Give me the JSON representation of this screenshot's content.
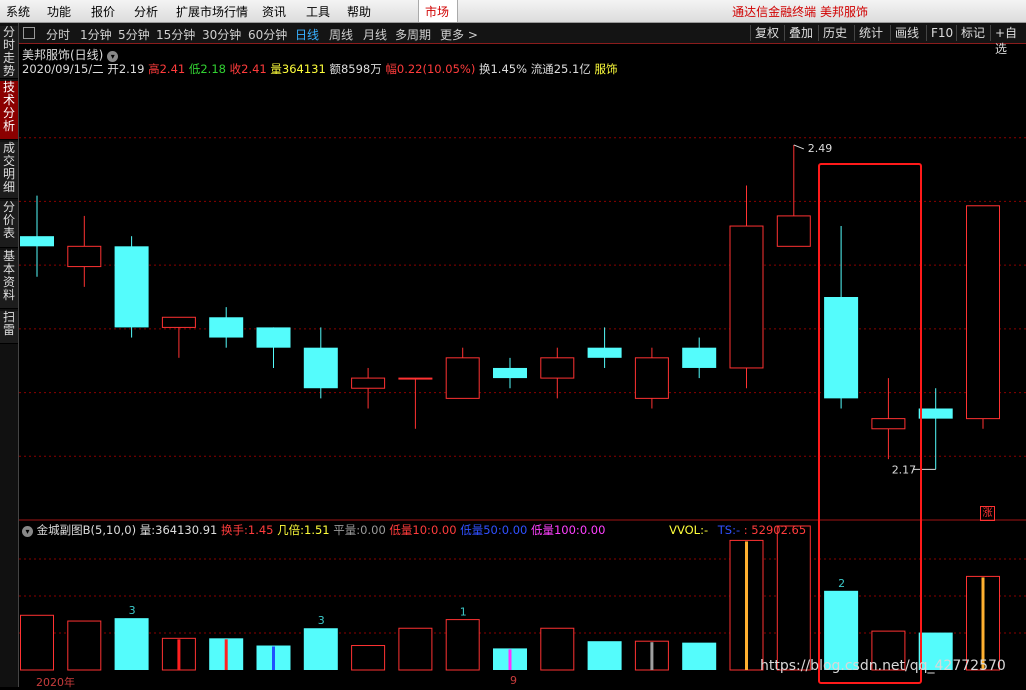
{
  "menu": {
    "items": [
      "系统",
      "功能",
      "报价",
      "分析",
      "扩展市场行情",
      "资讯",
      "工具",
      "帮助"
    ],
    "market_tab": "市场",
    "brand": "通达信金融终端  美邦服饰"
  },
  "side_tabs": [
    "分时走势",
    "技术分析",
    "成交明细",
    "分价表",
    "基本资料",
    "扫雷"
  ],
  "period_bar": {
    "items": [
      "分时",
      "1分钟",
      "5分钟",
      "15分钟",
      "30分钟",
      "60分钟",
      "日线",
      "周线",
      "月线",
      "多周期",
      "更多 >"
    ],
    "active": "日线",
    "right": [
      "复权",
      "叠加",
      "历史",
      "统计",
      "画线",
      "F10",
      "标记",
      "+自选"
    ]
  },
  "stock": {
    "title": "美邦服饰(日线)",
    "date": "2020/09/15/二",
    "open_label": "开",
    "open": "2.19",
    "high_label": "高",
    "high": "2.41",
    "low_label": "低",
    "low": "2.18",
    "close_label": "收",
    "close": "2.41",
    "vol_label": "量",
    "vol": "364131",
    "amt_label": "额",
    "amt": "8598万",
    "chg_label": "幅",
    "chg": "0.22(10.05%)",
    "turn_label": "换",
    "turn": "1.45%",
    "float_label": "流通",
    "float": "25.1亿",
    "sector": "服饰"
  },
  "indicator": {
    "name": "金城副图B(5,10,0)",
    "liang_label": "量:",
    "liang": "364130.91",
    "huanshou_label": "换手:",
    "huanshou": "1.45",
    "beibei_label": "几倍:",
    "beibei": "1.51",
    "pingliang_label": "平量:",
    "pingliang": "0.00",
    "dl10_label": "低量10:",
    "dl10": "0.00",
    "dl50_label": "低量50:",
    "dl50": "0.00",
    "dl100_label": "低量100:",
    "dl100": "0.00",
    "vvol_label": "VVOL:",
    "vvol": "-",
    "ts_label": "TS:",
    "ts": "-",
    "last": ":  52902.65"
  },
  "annotations": {
    "high_mark": "2.49",
    "low_mark": "2.17",
    "limit_badge": "涨",
    "year_label": "2020年",
    "month_label": "9",
    "watermark": "https://blog.csdn.net/qq_42772570"
  },
  "colors": {
    "up": "#ff3232",
    "down": "#54fcfc",
    "grid": "#8b0000",
    "highlight": "#ff1a1a"
  },
  "chart_data": {
    "type": "candlestick",
    "ylim": [
      2.12,
      2.56
    ],
    "candles": [
      {
        "o": 2.4,
        "h": 2.44,
        "l": 2.36,
        "c": 2.39
      },
      {
        "o": 2.37,
        "h": 2.42,
        "l": 2.35,
        "c": 2.39
      },
      {
        "o": 2.39,
        "h": 2.4,
        "l": 2.3,
        "c": 2.31
      },
      {
        "o": 2.31,
        "h": 2.32,
        "l": 2.28,
        "c": 2.32
      },
      {
        "o": 2.32,
        "h": 2.33,
        "l": 2.29,
        "c": 2.3
      },
      {
        "o": 2.31,
        "h": 2.31,
        "l": 2.27,
        "c": 2.29
      },
      {
        "o": 2.29,
        "h": 2.31,
        "l": 2.24,
        "c": 2.25
      },
      {
        "o": 2.25,
        "h": 2.27,
        "l": 2.23,
        "c": 2.26
      },
      {
        "o": 2.26,
        "h": 2.26,
        "l": 2.21,
        "c": 2.26
      },
      {
        "o": 2.24,
        "h": 2.29,
        "l": 2.24,
        "c": 2.28
      },
      {
        "o": 2.27,
        "h": 2.28,
        "l": 2.25,
        "c": 2.26
      },
      {
        "o": 2.26,
        "h": 2.29,
        "l": 2.24,
        "c": 2.28
      },
      {
        "o": 2.29,
        "h": 2.31,
        "l": 2.27,
        "c": 2.28
      },
      {
        "o": 2.24,
        "h": 2.29,
        "l": 2.23,
        "c": 2.28
      },
      {
        "o": 2.29,
        "h": 2.3,
        "l": 2.26,
        "c": 2.27
      },
      {
        "o": 2.27,
        "h": 2.45,
        "l": 2.25,
        "c": 2.41
      },
      {
        "o": 2.39,
        "h": 2.49,
        "l": 2.39,
        "c": 2.42
      },
      {
        "o": 2.34,
        "h": 2.41,
        "l": 2.23,
        "c": 2.24
      },
      {
        "o": 2.21,
        "h": 2.26,
        "l": 2.18,
        "c": 2.22
      },
      {
        "o": 2.23,
        "h": 2.25,
        "l": 2.17,
        "c": 2.22
      },
      {
        "o": 2.22,
        "h": 2.43,
        "l": 2.21,
        "c": 2.43
      }
    ],
    "volumes": [
      0.38,
      0.34,
      0.36,
      0.22,
      0.22,
      0.17,
      0.29,
      0.17,
      0.29,
      0.35,
      0.15,
      0.29,
      0.2,
      0.2,
      0.19,
      0.9,
      1.0,
      0.55,
      0.27,
      0.26,
      0.65
    ],
    "vol_up": [
      true,
      true,
      false,
      true,
      false,
      false,
      false,
      true,
      true,
      true,
      false,
      true,
      false,
      true,
      false,
      true,
      true,
      false,
      true,
      false,
      true
    ],
    "vol_marks": [
      null,
      null,
      null,
      "#ff2020",
      "#ff2020",
      "#2050ff",
      null,
      null,
      null,
      null,
      "#ff30ff",
      null,
      null,
      "#a0a0a0",
      null,
      "#ffb030",
      null,
      null,
      null,
      null,
      "#ffb030"
    ],
    "vol_labels": [
      null,
      null,
      "3",
      null,
      null,
      null,
      "3",
      null,
      null,
      "1",
      null,
      null,
      null,
      null,
      null,
      null,
      null,
      "2",
      null,
      null,
      null
    ]
  }
}
